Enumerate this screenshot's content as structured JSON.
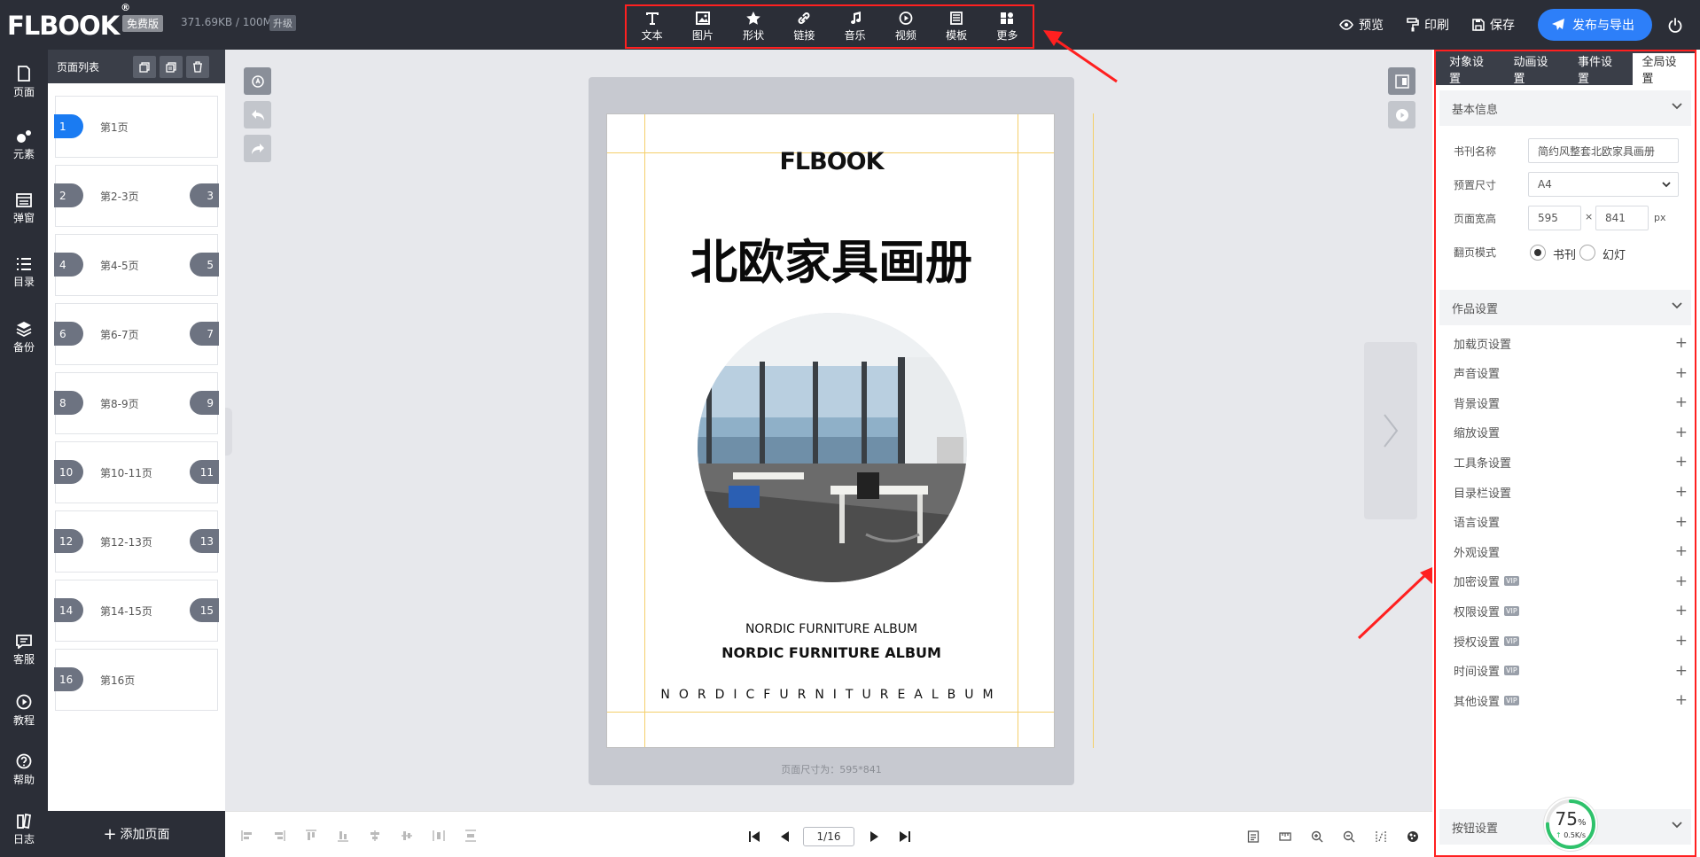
{
  "app": {
    "logo": "FLBOOK",
    "edition": "免费版",
    "storage": "371.69KB / 100M",
    "upgrade": "升级"
  },
  "toolbar": {
    "tools": [
      {
        "icon": "text-icon",
        "label": "文本"
      },
      {
        "icon": "image-icon",
        "label": "图片"
      },
      {
        "icon": "star-icon",
        "label": "形状"
      },
      {
        "icon": "link-icon",
        "label": "链接"
      },
      {
        "icon": "music-icon",
        "label": "音乐"
      },
      {
        "icon": "video-icon",
        "label": "视频"
      },
      {
        "icon": "template-icon",
        "label": "模板"
      },
      {
        "icon": "more-icon",
        "label": "更多"
      }
    ]
  },
  "header_actions": {
    "preview": "预览",
    "print": "印刷",
    "save": "保存",
    "publish": "发布与导出"
  },
  "left_rail": [
    {
      "icon": "page-icon",
      "label": "页面"
    },
    {
      "icon": "elements-icon",
      "label": "元素"
    },
    {
      "icon": "popup-icon",
      "label": "弹窗"
    },
    {
      "icon": "toc-icon",
      "label": "目录"
    },
    {
      "icon": "backup-icon",
      "label": "备份"
    },
    {
      "icon": "support-icon",
      "label": "客服"
    },
    {
      "icon": "tutorial-icon",
      "label": "教程"
    },
    {
      "icon": "help-icon",
      "label": "帮助"
    },
    {
      "icon": "log-icon",
      "label": "日志"
    }
  ],
  "page_list": {
    "title": "页面列表",
    "add_page": "添加页面",
    "pages": [
      {
        "left": "1",
        "right": "",
        "label": "第1页",
        "active": true
      },
      {
        "left": "2",
        "right": "3",
        "label": "第2-3页"
      },
      {
        "left": "4",
        "right": "5",
        "label": "第4-5页"
      },
      {
        "left": "6",
        "right": "7",
        "label": "第6-7页"
      },
      {
        "left": "8",
        "right": "9",
        "label": "第8-9页"
      },
      {
        "left": "10",
        "right": "11",
        "label": "第10-11页"
      },
      {
        "left": "12",
        "right": "13",
        "label": "第12-13页"
      },
      {
        "left": "14",
        "right": "15",
        "label": "第14-15页"
      },
      {
        "left": "16",
        "right": "",
        "label": "第16页"
      }
    ]
  },
  "canvas_page": {
    "logo": "FLBOOK",
    "title": "北欧家具画册",
    "subtitle1": "NORDIC FURNITURE ALBUM",
    "subtitle2": "NORDIC FURNITURE ALBUM",
    "subtitle3": "NORDICFURNITUREALBUM",
    "page_size_note": "页面尺寸为：595*841"
  },
  "pager": {
    "current": "1/16"
  },
  "right_panel": {
    "tabs": [
      {
        "label": "对象设置",
        "active": false
      },
      {
        "label": "动画设置",
        "active": false
      },
      {
        "label": "事件设置",
        "active": false
      },
      {
        "label": "全局设置",
        "active": true
      }
    ],
    "basic_info": {
      "header": "基本信息",
      "book_name_label": "书刊名称",
      "book_name_value": "简约风整套北欧家具画册",
      "preset_label": "预置尺寸",
      "preset_value": "A4",
      "size_label": "页面宽高",
      "width": "595",
      "times": "×",
      "height": "841",
      "unit": "px",
      "flip_label": "翻页模式",
      "flip_book": "书刊",
      "flip_slide": "幻灯"
    },
    "work_settings": {
      "header": "作品设置",
      "items": [
        {
          "label": "加载页设置",
          "vip": false
        },
        {
          "label": "声音设置",
          "vip": false
        },
        {
          "label": "背景设置",
          "vip": false
        },
        {
          "label": "缩放设置",
          "vip": false
        },
        {
          "label": "工具条设置",
          "vip": false
        },
        {
          "label": "目录栏设置",
          "vip": false
        },
        {
          "label": "语言设置",
          "vip": false
        },
        {
          "label": "外观设置",
          "vip": false
        },
        {
          "label": "加密设置",
          "vip": true
        },
        {
          "label": "权限设置",
          "vip": true
        },
        {
          "label": "授权设置",
          "vip": true
        },
        {
          "label": "时间设置",
          "vip": true
        },
        {
          "label": "其他设置",
          "vip": true
        }
      ],
      "vip_tag": "VIP"
    },
    "button_settings": {
      "header": "按钮设置"
    }
  },
  "speed_widget": {
    "percent": "75",
    "percent_sign": "%",
    "rate": "0.5K/s",
    "progress": 0.75
  },
  "colors": {
    "accent": "#2d7ff9",
    "annotation": "#ff2020",
    "dark": "#2b2e37",
    "guide": "#f4cf6a"
  }
}
